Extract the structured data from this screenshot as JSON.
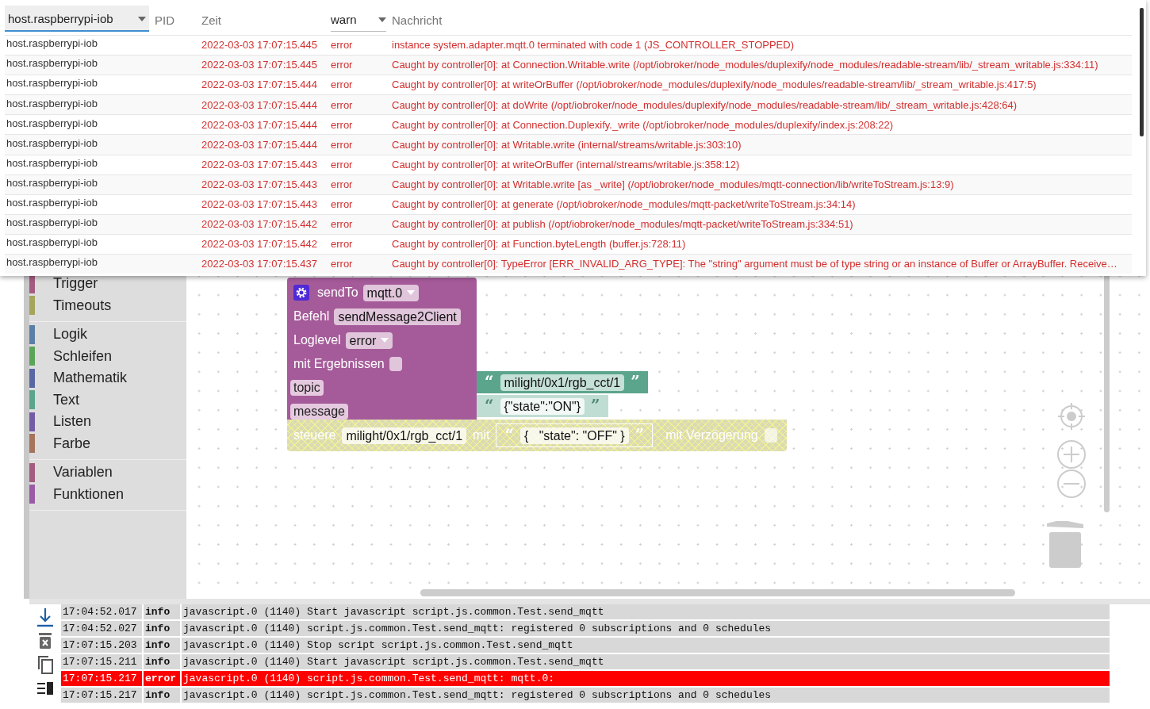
{
  "log_filters": {
    "host": "host.raspberrypi-iob",
    "pid_placeholder": "PID",
    "time_placeholder": "Zeit",
    "level": "warn",
    "message_placeholder": "Nachricht"
  },
  "log_rows": [
    {
      "host": "host.raspberrypi-iob",
      "time": "2022-03-03 17:07:15.445",
      "level": "error",
      "message": "instance system.adapter.mqtt.0 terminated with code 1 (JS_CONTROLLER_STOPPED)"
    },
    {
      "host": "host.raspberrypi-iob",
      "time": "2022-03-03 17:07:15.445",
      "level": "error",
      "message": "Caught by controller[0]: at Connection.Writable.write (/opt/iobroker/node_modules/duplexify/node_modules/readable-stream/lib/_stream_writable.js:334:11)"
    },
    {
      "host": "host.raspberrypi-iob",
      "time": "2022-03-03 17:07:15.444",
      "level": "error",
      "message": "Caught by controller[0]: at writeOrBuffer (/opt/iobroker/node_modules/duplexify/node_modules/readable-stream/lib/_stream_writable.js:417:5)"
    },
    {
      "host": "host.raspberrypi-iob",
      "time": "2022-03-03 17:07:15.444",
      "level": "error",
      "message": "Caught by controller[0]: at doWrite (/opt/iobroker/node_modules/duplexify/node_modules/readable-stream/lib/_stream_writable.js:428:64)"
    },
    {
      "host": "host.raspberrypi-iob",
      "time": "2022-03-03 17:07:15.444",
      "level": "error",
      "message": "Caught by controller[0]: at Connection.Duplexify._write (/opt/iobroker/node_modules/duplexify/index.js:208:22)"
    },
    {
      "host": "host.raspberrypi-iob",
      "time": "2022-03-03 17:07:15.444",
      "level": "error",
      "message": "Caught by controller[0]: at Writable.write (internal/streams/writable.js:303:10)"
    },
    {
      "host": "host.raspberrypi-iob",
      "time": "2022-03-03 17:07:15.443",
      "level": "error",
      "message": "Caught by controller[0]: at writeOrBuffer (internal/streams/writable.js:358:12)"
    },
    {
      "host": "host.raspberrypi-iob",
      "time": "2022-03-03 17:07:15.443",
      "level": "error",
      "message": "Caught by controller[0]: at Writable.write [as _write] (/opt/iobroker/node_modules/mqtt-connection/lib/writeToStream.js:13:9)"
    },
    {
      "host": "host.raspberrypi-iob",
      "time": "2022-03-03 17:07:15.443",
      "level": "error",
      "message": "Caught by controller[0]: at generate (/opt/iobroker/node_modules/mqtt-packet/writeToStream.js:34:14)"
    },
    {
      "host": "host.raspberrypi-iob",
      "time": "2022-03-03 17:07:15.442",
      "level": "error",
      "message": "Caught by controller[0]: at publish (/opt/iobroker/node_modules/mqtt-packet/writeToStream.js:334:51)"
    },
    {
      "host": "host.raspberrypi-iob",
      "time": "2022-03-03 17:07:15.442",
      "level": "error",
      "message": "Caught by controller[0]: at Function.byteLength (buffer.js:728:11)"
    },
    {
      "host": "host.raspberrypi-iob",
      "time": "2022-03-03 17:07:15.437",
      "level": "error",
      "message": "Caught by controller[0]: TypeError [ERR_INVALID_ARG_TYPE]: The \"string\" argument must be of type string or an instance of Buffer or ArrayBuffer. Receive…"
    }
  ],
  "category_groups": [
    {
      "items": [
        {
          "label": "Trigger",
          "color": "#a55b80"
        },
        {
          "label": "Timeouts",
          "color": "#a5a55b"
        }
      ]
    },
    {
      "items": [
        {
          "label": "Logik",
          "color": "#5b80a5"
        },
        {
          "label": "Schleifen",
          "color": "#5ba55b"
        },
        {
          "label": "Mathematik",
          "color": "#5b67a5"
        },
        {
          "label": "Text",
          "color": "#5ba58c"
        },
        {
          "label": "Listen",
          "color": "#745ba5"
        },
        {
          "label": "Farbe",
          "color": "#a5745b"
        }
      ]
    },
    {
      "items": [
        {
          "label": "Variablen",
          "color": "#a55b80"
        },
        {
          "label": "Funktionen",
          "color": "#995ba5"
        }
      ]
    }
  ],
  "send_to_block": {
    "title": "sendTo",
    "instance": "mqtt.0",
    "command_label": "Befehl",
    "command": "sendMessage2Client",
    "loglevel_label": "Loglevel",
    "loglevel": "error",
    "results_label": "mit Ergebnissen",
    "results_checked": false,
    "inputs": [
      "topic",
      "message"
    ]
  },
  "text_blocks": [
    {
      "open_quote": "“",
      "text": "milight/0x1/rgb_cct/1",
      "close_quote": "”",
      "shadow": false
    },
    {
      "open_quote": "“",
      "text": "{\"state\":\"ON\"}",
      "close_quote": "”",
      "shadow": true
    }
  ],
  "control_block": {
    "disabled": true,
    "label": "steuere",
    "target": "milight/0x1/rgb_cct/1",
    "with_label": "mit",
    "open_quote": "“",
    "value": "{   \"state\": \"OFF\" }",
    "close_quote": "”",
    "delay_label": "mit Verzögerung",
    "delay_checked": false
  },
  "console_rows": [
    {
      "time": "17:04:52.017",
      "level": "info",
      "source": "javascript.0 (1140)",
      "message": "Start javascript script.js.common.Test.send_mqtt",
      "highlighted": false
    },
    {
      "time": "17:04:52.027",
      "level": "info",
      "source": "javascript.0 (1140)",
      "message": "script.js.common.Test.send_mqtt: registered 0 subscriptions and 0 schedules",
      "highlighted": false
    },
    {
      "time": "17:07:15.203",
      "level": "info",
      "source": "javascript.0 (1140)",
      "message": "Stop script script.js.common.Test.send_mqtt",
      "highlighted": false
    },
    {
      "time": "17:07:15.211",
      "level": "info",
      "source": "javascript.0 (1140)",
      "message": "Start javascript script.js.common.Test.send_mqtt",
      "highlighted": false
    },
    {
      "time": "17:07:15.217",
      "level": "error",
      "source": "javascript.0 (1140)",
      "message": "script.js.common.Test.send_mqtt: mqtt.0:",
      "highlighted": true
    },
    {
      "time": "17:07:15.217",
      "level": "info",
      "source": "javascript.0 (1140)",
      "message": "script.js.common.Test.send_mqtt: registered 0 subscriptions and 0 schedules",
      "highlighted": false
    }
  ]
}
